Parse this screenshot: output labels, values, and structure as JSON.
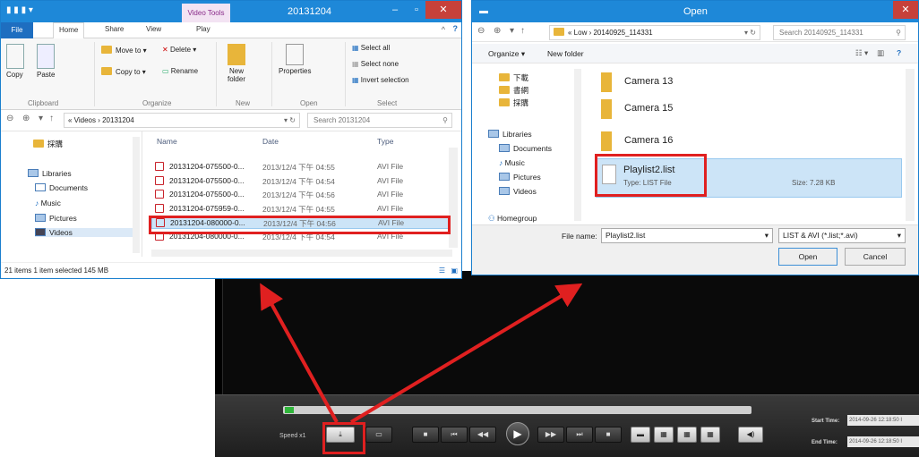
{
  "player": {
    "speed": "Speed x1",
    "start_label": "Start Time:",
    "start_value": "2014-09-26 12:18:50 I",
    "end_label": "End Time:",
    "end_value": "2014-09-26 12:18:50 I",
    "progress": 0.02
  },
  "explorer": {
    "context_tab": "Video Tools",
    "title": "20131204",
    "tabs": [
      "File",
      "Home",
      "Share",
      "View",
      "Play"
    ],
    "ribbon": {
      "copy": "Copy",
      "paste": "Paste",
      "move_to": "Move to ▾",
      "copy_to": "Copy to ▾",
      "delete": "Delete ▾",
      "rename": "Rename",
      "new_folder": "New folder",
      "properties": "Properties",
      "select_all": "Select all",
      "select_none": "Select none",
      "invert_selection": "Invert selection",
      "groups": [
        "Clipboard",
        "Organize",
        "New",
        "Open",
        "Select"
      ]
    },
    "path": "« Videos › 20131204",
    "search": "Search 20131204",
    "sidebar": [
      "採購",
      "Libraries",
      "Documents",
      "Music",
      "Pictures",
      "Videos"
    ],
    "columns": [
      "Name",
      "Date",
      "Type"
    ],
    "files": [
      {
        "name": "20131204-075500-0...",
        "date": "2013/12/4 下午 04:55",
        "type": "AVI File"
      },
      {
        "name": "20131204-075500-0...",
        "date": "2013/12/4 下午 04:54",
        "type": "AVI File"
      },
      {
        "name": "20131204-075500-0...",
        "date": "2013/12/4 下午 04:56",
        "type": "AVI File"
      },
      {
        "name": "20131204-075959-0...",
        "date": "2013/12/4 下午 04:55",
        "type": "AVI File"
      },
      {
        "name": "20131204-080000-0...",
        "date": "2013/12/4 下午 04:56",
        "type": "AVI File"
      },
      {
        "name": "20131204-080000-0...",
        "date": "2013/12/4 下午 04:54",
        "type": "AVI File"
      }
    ],
    "status": "21 items     1 item selected  145 MB"
  },
  "open": {
    "title": "Open",
    "path": "« Low › 20140925_114331",
    "search": "Search 20140925_114331",
    "organize": "Organize ▾",
    "new_folder": "New folder",
    "sidebar": [
      "下載",
      "書網",
      "採購",
      "Libraries",
      "Documents",
      "Music",
      "Pictures",
      "Videos",
      "Homegroup"
    ],
    "folders": [
      "Camera 13",
      "Camera 15",
      "Camera 16"
    ],
    "file": {
      "name": "Playlist2.list",
      "type": "Type: LIST File",
      "size": "Size: 7.28 KB"
    },
    "filename_label": "File name:",
    "filename_value": "Playlist2.list",
    "filter": "LIST & AVI (*.list;*.avi)",
    "open_btn": "Open",
    "cancel_btn": "Cancel"
  }
}
